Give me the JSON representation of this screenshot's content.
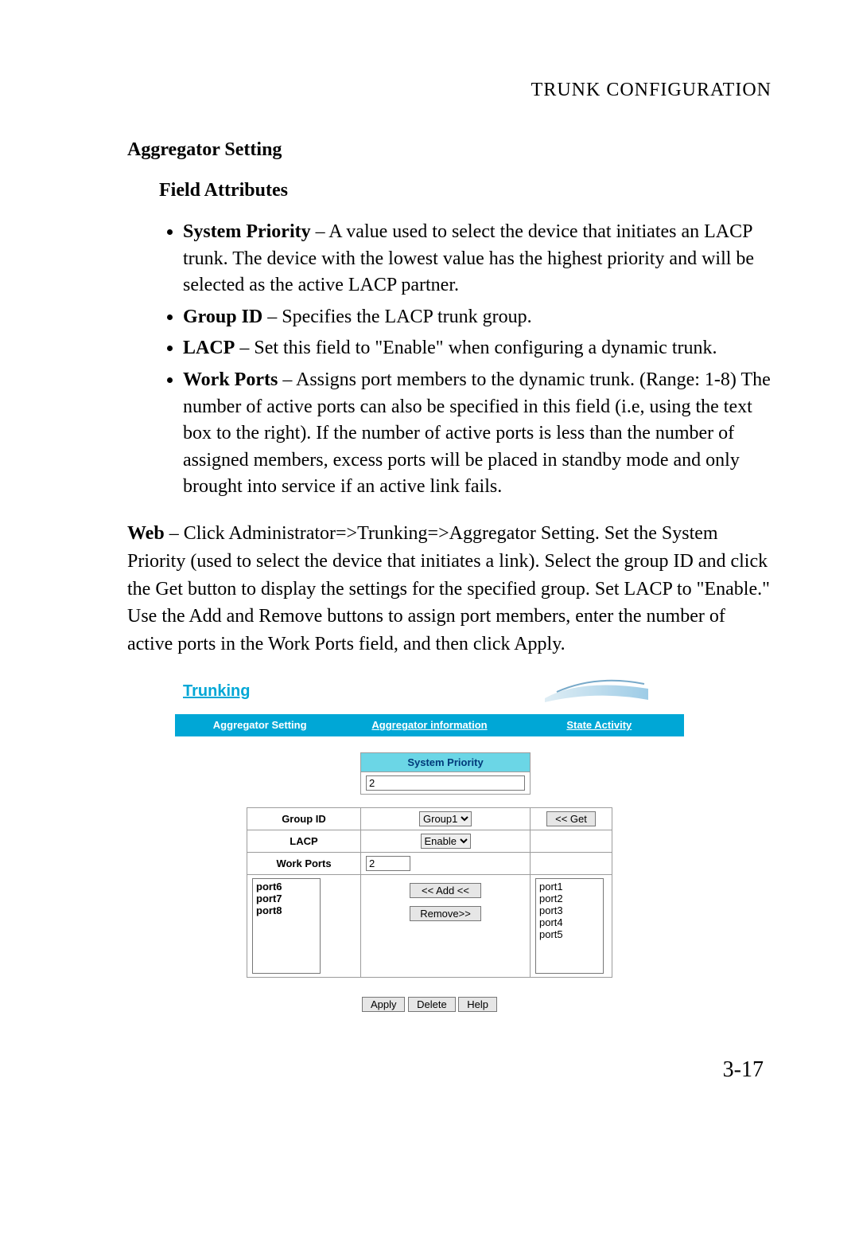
{
  "running_head": "TRUNK CONFIGURATION",
  "section_title": "Aggregator Setting",
  "field_attributes_heading": "Field Attributes",
  "bullets": [
    {
      "term": "System Priority",
      "desc": " – A value used to select the device that initiates an LACP trunk. The device with the lowest value has the highest priority and will be selected as the active LACP partner."
    },
    {
      "term": "Group ID",
      "desc": " – Specifies the LACP trunk group."
    },
    {
      "term": "LACP",
      "desc": " – Set this field to \"Enable\" when configuring a dynamic trunk."
    },
    {
      "term": "Work Ports",
      "desc": " – Assigns port members to the dynamic trunk. (Range: 1-8) The number of active ports can also be specified in this field (i.e, using the text box to the right). If the number of active ports is less than the number of assigned members, excess ports will be placed in standby mode and only brought into service if an active link fails."
    }
  ],
  "web_para_lead": "Web",
  "web_para_rest": " – Click Administrator=>Trunking=>Aggregator Setting. Set the System Priority (used to select the device that initiates a link). Select the group ID and click the Get button to display the settings for the specified group. Set LACP to \"Enable.\" Use the Add and Remove buttons to assign port members, enter the number of active ports in the Work Ports field, and then click Apply.",
  "page_number": "3-17",
  "shot": {
    "banner_title": "Trunking",
    "tabs": {
      "active": "Aggregator Setting",
      "link1": "Aggregator information",
      "link2": "State Activity"
    },
    "system_priority": {
      "label": "System Priority",
      "value": "2"
    },
    "group_id": {
      "label": "Group ID",
      "value": "Group1"
    },
    "lacp": {
      "label": "LACP",
      "value": "Enable"
    },
    "work_ports": {
      "label": "Work Ports",
      "value": "2"
    },
    "get_btn": "<< Get",
    "add_btn": "<< Add <<",
    "remove_btn": "Remove>>",
    "left_ports": [
      "port6",
      "port7",
      "port8"
    ],
    "right_ports": [
      "port1",
      "port2",
      "port3",
      "port4",
      "port5"
    ],
    "apply_btn": "Apply",
    "delete_btn": "Delete",
    "help_btn": "Help"
  }
}
